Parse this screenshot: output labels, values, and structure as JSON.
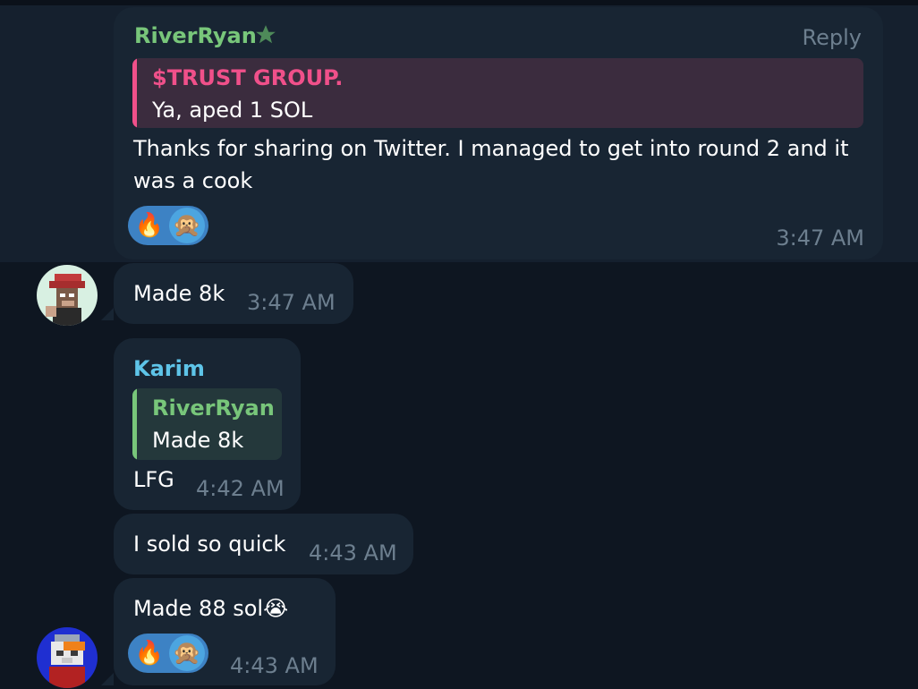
{
  "messages": [
    {
      "sender": "RiverRyan",
      "sender_color": "#78c67a",
      "reply_link": "Reply",
      "quote_title": "$TRUST GROUP.",
      "quote_title_color": "#f0508a",
      "quote_text": "Ya, aped 1 SOL",
      "text_line1": "Thanks for sharing on Twitter. I managed to get into round 2 and it",
      "text_line2": "was a cook",
      "reactions": [
        "🔥",
        "🙊"
      ],
      "time": "3:47 AM"
    },
    {
      "text": "Made 8k",
      "time": "3:47 AM"
    },
    {
      "sender": "Karim",
      "sender_color": "#5ec4e8",
      "quote_title": "RiverRyan",
      "quote_title_color": "#78c67a",
      "quote_text": "Made 8k",
      "text": "LFG",
      "time": "4:42 AM"
    },
    {
      "text": "I sold so quick",
      "time": "4:43 AM"
    },
    {
      "text": "Made 88 sol😭",
      "reactions": [
        "🔥",
        "🙊"
      ],
      "time": "4:43 AM"
    }
  ],
  "icons": {
    "star": "star-icon",
    "avatar1": "ape-avatar",
    "avatar2": "cat-avatar"
  }
}
